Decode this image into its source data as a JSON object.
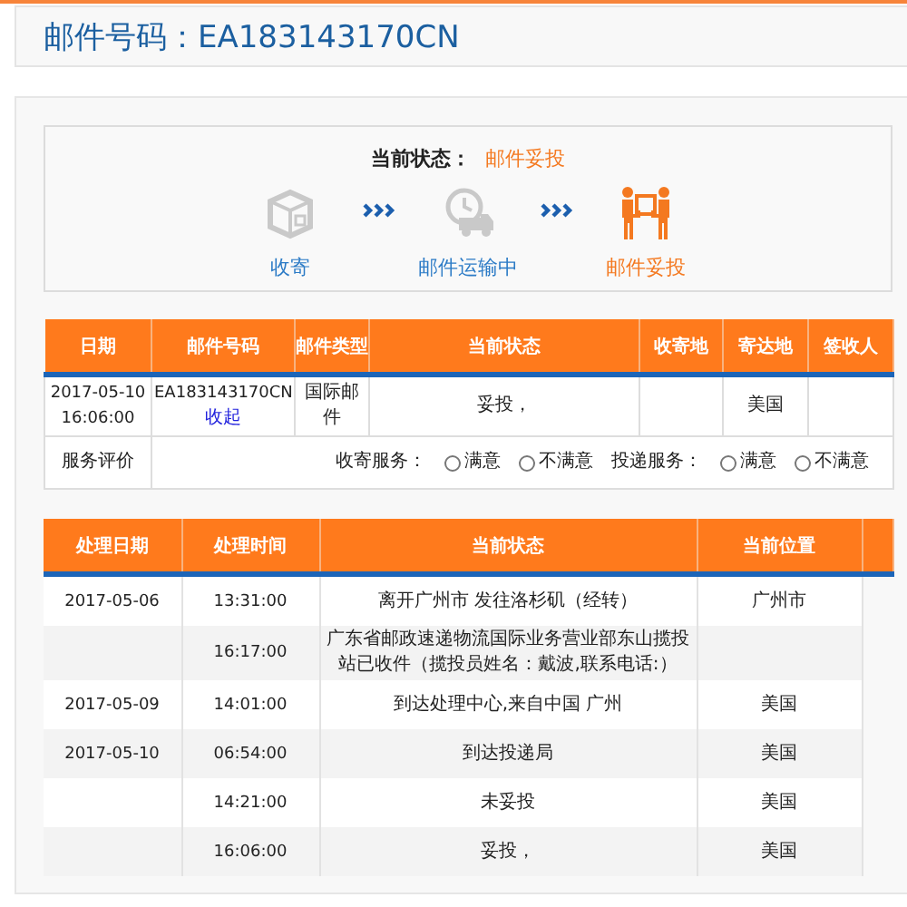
{
  "header": {
    "title": "邮件号码：EA183143170CN"
  },
  "status": {
    "label": "当前状态：",
    "value": "邮件妥投",
    "steps": [
      {
        "label": "收寄",
        "kind": "box",
        "active": false
      },
      {
        "label": "邮件运输中",
        "kind": "truck",
        "active": false
      },
      {
        "label": "邮件妥投",
        "kind": "handover",
        "active": true
      }
    ]
  },
  "info_table": {
    "columns": [
      "日期",
      "邮件号码",
      "邮件类型",
      "当前状态",
      "收寄地",
      "寄达地",
      "签收人"
    ],
    "rows": [
      {
        "date": "2017-05-10 16:06:00",
        "number": "EA183143170CN",
        "toggle_link": "收起",
        "mail_type": "国际邮件",
        "status": "妥投，",
        "destination": "美国"
      }
    ],
    "rating": {
      "label": "服务评价",
      "groups": [
        {
          "label": "收寄服务：",
          "options": [
            {
              "label": "满意",
              "selected": false
            },
            {
              "label": "不满意",
              "selected": false
            }
          ]
        },
        {
          "label": "投递服务：",
          "options": [
            {
              "label": "满意",
              "selected": false
            },
            {
              "label": "不满意",
              "selected": false
            }
          ]
        }
      ]
    }
  },
  "track_table": {
    "columns": [
      "处理日期",
      "处理时间",
      "当前状态",
      "当前位置"
    ],
    "rows": [
      {
        "date": "2017-05-06",
        "time": "13:31:00",
        "status": "离开广州市 发往洛杉矶（经转）",
        "location": "广州市"
      },
      {
        "time": "16:17:00",
        "status": "广东省邮政速递物流国际业务营业部东山揽投站已收件（揽投员姓名：戴波,联系电话:）"
      },
      {
        "date": "2017-05-09",
        "time": "14:01:00",
        "status": "到达处理中心,来自中国 广州",
        "location": "美国"
      },
      {
        "date": "2017-05-10",
        "time": "06:54:00",
        "status": "到达投递局",
        "location": "美国"
      },
      {
        "time": "14:21:00",
        "status": "未妥投",
        "location": "美国"
      },
      {
        "time": "16:06:00",
        "status": "妥投，",
        "location": "美国"
      }
    ]
  }
}
